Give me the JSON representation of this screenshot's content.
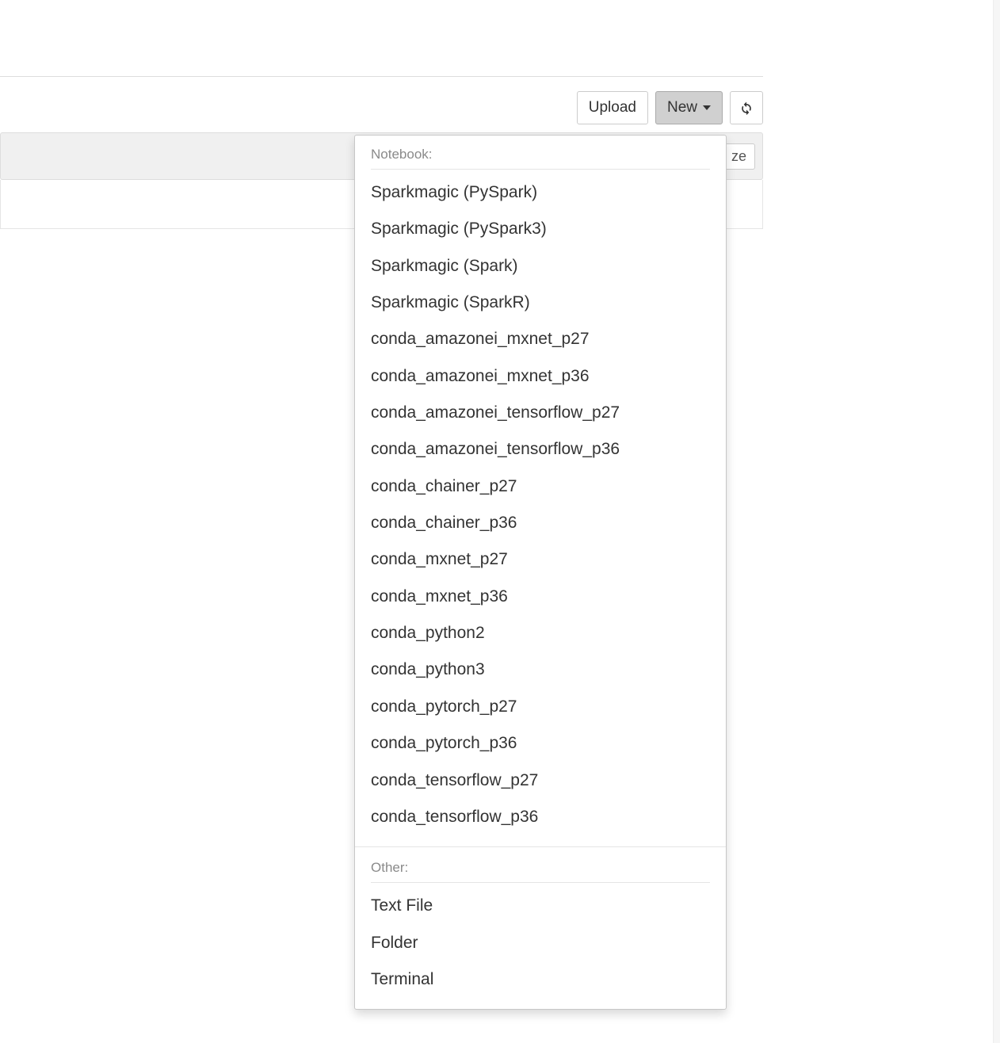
{
  "toolbar": {
    "upload_label": "Upload",
    "new_label": "New",
    "refresh_title": "Refresh"
  },
  "list_header": {
    "size_fragment": "ze"
  },
  "dropdown": {
    "notebook_label": "Notebook:",
    "other_label": "Other:",
    "notebook_items": [
      "Sparkmagic (PySpark)",
      "Sparkmagic (PySpark3)",
      "Sparkmagic (Spark)",
      "Sparkmagic (SparkR)",
      "conda_amazonei_mxnet_p27",
      "conda_amazonei_mxnet_p36",
      "conda_amazonei_tensorflow_p27",
      "conda_amazonei_tensorflow_p36",
      "conda_chainer_p27",
      "conda_chainer_p36",
      "conda_mxnet_p27",
      "conda_mxnet_p36",
      "conda_python2",
      "conda_python3",
      "conda_pytorch_p27",
      "conda_pytorch_p36",
      "conda_tensorflow_p27",
      "conda_tensorflow_p36"
    ],
    "other_items": [
      "Text File",
      "Folder",
      "Terminal"
    ]
  }
}
